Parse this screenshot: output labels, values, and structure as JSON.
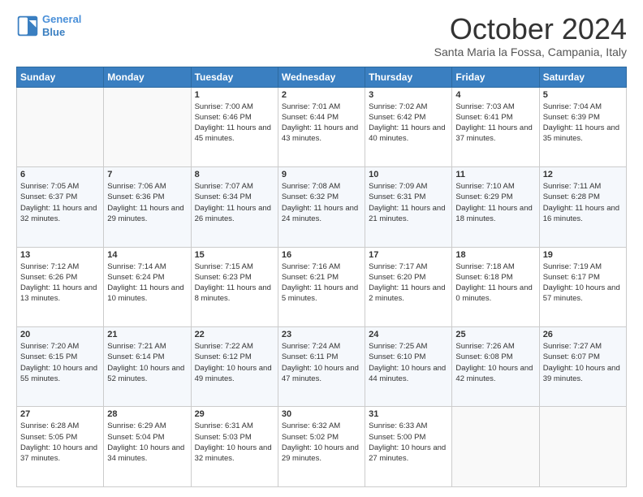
{
  "header": {
    "logo_line1": "General",
    "logo_line2": "Blue",
    "month_title": "October 2024",
    "location": "Santa Maria la Fossa, Campania, Italy"
  },
  "days_of_week": [
    "Sunday",
    "Monday",
    "Tuesday",
    "Wednesday",
    "Thursday",
    "Friday",
    "Saturday"
  ],
  "weeks": [
    [
      {
        "day": "",
        "content": ""
      },
      {
        "day": "",
        "content": ""
      },
      {
        "day": "1",
        "content": "Sunrise: 7:00 AM\nSunset: 6:46 PM\nDaylight: 11 hours and 45 minutes."
      },
      {
        "day": "2",
        "content": "Sunrise: 7:01 AM\nSunset: 6:44 PM\nDaylight: 11 hours and 43 minutes."
      },
      {
        "day": "3",
        "content": "Sunrise: 7:02 AM\nSunset: 6:42 PM\nDaylight: 11 hours and 40 minutes."
      },
      {
        "day": "4",
        "content": "Sunrise: 7:03 AM\nSunset: 6:41 PM\nDaylight: 11 hours and 37 minutes."
      },
      {
        "day": "5",
        "content": "Sunrise: 7:04 AM\nSunset: 6:39 PM\nDaylight: 11 hours and 35 minutes."
      }
    ],
    [
      {
        "day": "6",
        "content": "Sunrise: 7:05 AM\nSunset: 6:37 PM\nDaylight: 11 hours and 32 minutes."
      },
      {
        "day": "7",
        "content": "Sunrise: 7:06 AM\nSunset: 6:36 PM\nDaylight: 11 hours and 29 minutes."
      },
      {
        "day": "8",
        "content": "Sunrise: 7:07 AM\nSunset: 6:34 PM\nDaylight: 11 hours and 26 minutes."
      },
      {
        "day": "9",
        "content": "Sunrise: 7:08 AM\nSunset: 6:32 PM\nDaylight: 11 hours and 24 minutes."
      },
      {
        "day": "10",
        "content": "Sunrise: 7:09 AM\nSunset: 6:31 PM\nDaylight: 11 hours and 21 minutes."
      },
      {
        "day": "11",
        "content": "Sunrise: 7:10 AM\nSunset: 6:29 PM\nDaylight: 11 hours and 18 minutes."
      },
      {
        "day": "12",
        "content": "Sunrise: 7:11 AM\nSunset: 6:28 PM\nDaylight: 11 hours and 16 minutes."
      }
    ],
    [
      {
        "day": "13",
        "content": "Sunrise: 7:12 AM\nSunset: 6:26 PM\nDaylight: 11 hours and 13 minutes."
      },
      {
        "day": "14",
        "content": "Sunrise: 7:14 AM\nSunset: 6:24 PM\nDaylight: 11 hours and 10 minutes."
      },
      {
        "day": "15",
        "content": "Sunrise: 7:15 AM\nSunset: 6:23 PM\nDaylight: 11 hours and 8 minutes."
      },
      {
        "day": "16",
        "content": "Sunrise: 7:16 AM\nSunset: 6:21 PM\nDaylight: 11 hours and 5 minutes."
      },
      {
        "day": "17",
        "content": "Sunrise: 7:17 AM\nSunset: 6:20 PM\nDaylight: 11 hours and 2 minutes."
      },
      {
        "day": "18",
        "content": "Sunrise: 7:18 AM\nSunset: 6:18 PM\nDaylight: 11 hours and 0 minutes."
      },
      {
        "day": "19",
        "content": "Sunrise: 7:19 AM\nSunset: 6:17 PM\nDaylight: 10 hours and 57 minutes."
      }
    ],
    [
      {
        "day": "20",
        "content": "Sunrise: 7:20 AM\nSunset: 6:15 PM\nDaylight: 10 hours and 55 minutes."
      },
      {
        "day": "21",
        "content": "Sunrise: 7:21 AM\nSunset: 6:14 PM\nDaylight: 10 hours and 52 minutes."
      },
      {
        "day": "22",
        "content": "Sunrise: 7:22 AM\nSunset: 6:12 PM\nDaylight: 10 hours and 49 minutes."
      },
      {
        "day": "23",
        "content": "Sunrise: 7:24 AM\nSunset: 6:11 PM\nDaylight: 10 hours and 47 minutes."
      },
      {
        "day": "24",
        "content": "Sunrise: 7:25 AM\nSunset: 6:10 PM\nDaylight: 10 hours and 44 minutes."
      },
      {
        "day": "25",
        "content": "Sunrise: 7:26 AM\nSunset: 6:08 PM\nDaylight: 10 hours and 42 minutes."
      },
      {
        "day": "26",
        "content": "Sunrise: 7:27 AM\nSunset: 6:07 PM\nDaylight: 10 hours and 39 minutes."
      }
    ],
    [
      {
        "day": "27",
        "content": "Sunrise: 6:28 AM\nSunset: 5:05 PM\nDaylight: 10 hours and 37 minutes."
      },
      {
        "day": "28",
        "content": "Sunrise: 6:29 AM\nSunset: 5:04 PM\nDaylight: 10 hours and 34 minutes."
      },
      {
        "day": "29",
        "content": "Sunrise: 6:31 AM\nSunset: 5:03 PM\nDaylight: 10 hours and 32 minutes."
      },
      {
        "day": "30",
        "content": "Sunrise: 6:32 AM\nSunset: 5:02 PM\nDaylight: 10 hours and 29 minutes."
      },
      {
        "day": "31",
        "content": "Sunrise: 6:33 AM\nSunset: 5:00 PM\nDaylight: 10 hours and 27 minutes."
      },
      {
        "day": "",
        "content": ""
      },
      {
        "day": "",
        "content": ""
      }
    ]
  ]
}
